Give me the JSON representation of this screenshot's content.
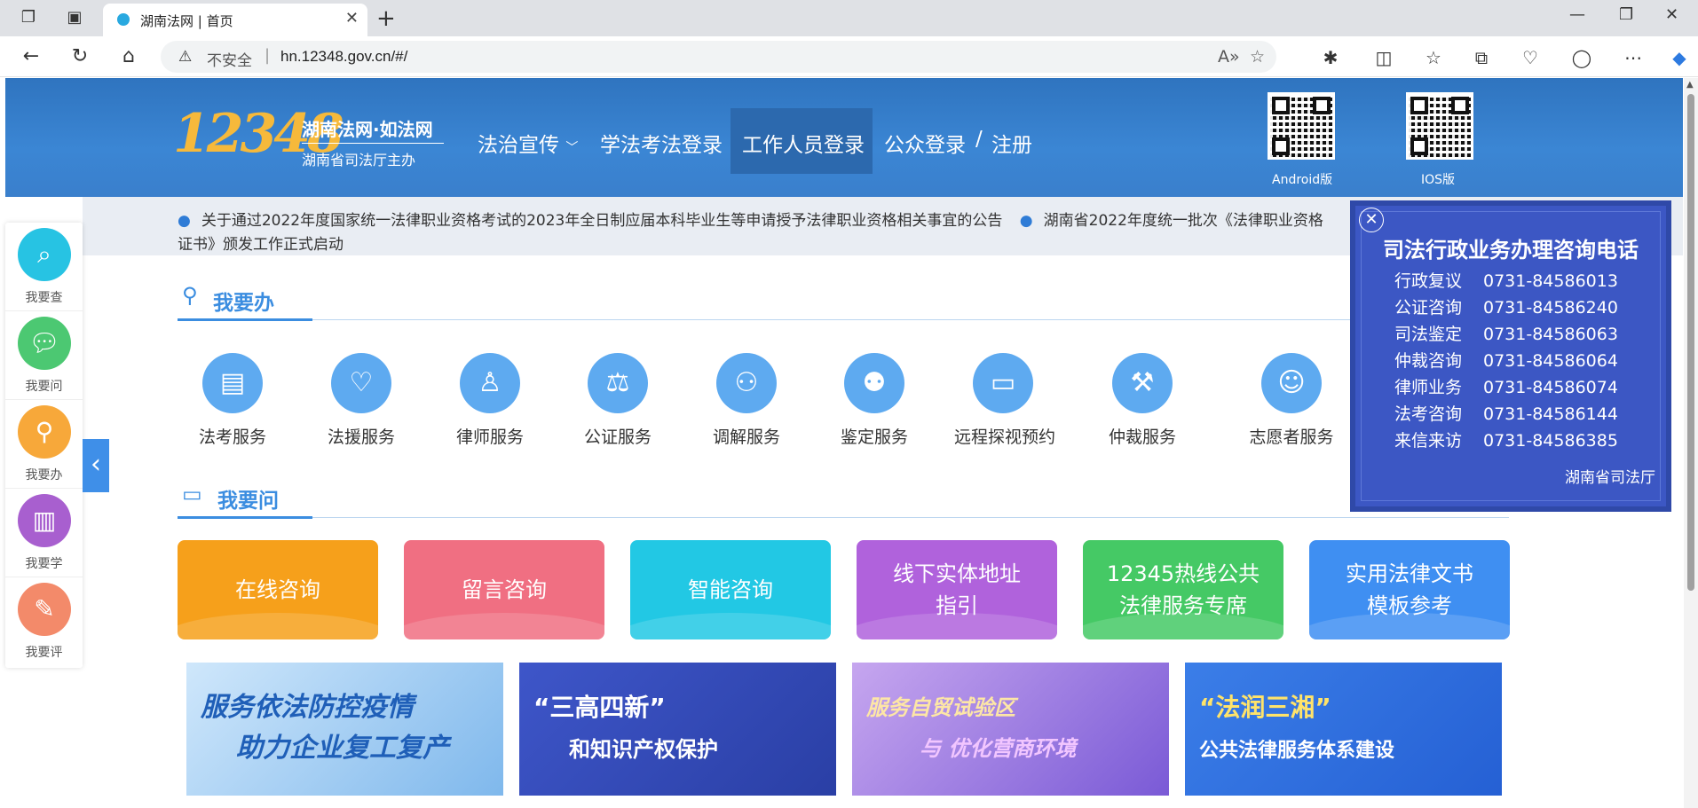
{
  "browser": {
    "tab_title": "湖南法网 | 首页",
    "security_label": "不安全",
    "url": "hn.12348.gov.cn/#/"
  },
  "site": {
    "logo_number": "12348",
    "logo_title": "湖南法网·如法网",
    "logo_subtitle": "湖南省司法厅主办",
    "nav": {
      "propaganda": "法治宣传",
      "exam_login": "学法考法登录",
      "staff_login": "工作人员登录",
      "public_login": "公众登录",
      "slash": "/",
      "register": "注册"
    },
    "qr": [
      {
        "label": "Android版"
      },
      {
        "label": "IOS版"
      }
    ],
    "notices": [
      "关于通过2022年度国家统一法律职业资格考试的2023年全日制应届本科毕业生等申请授予法律职业资格相关事宜的公告",
      "湖南省2022年度统一批次《法律职业资格证书》颁发工作正式启动"
    ]
  },
  "sidebar": [
    {
      "label": "我要查",
      "icon": "search-doc-icon",
      "color": "#27c3e3"
    },
    {
      "label": "我要问",
      "icon": "chat-icon",
      "color": "#4cc872"
    },
    {
      "label": "我要办",
      "icon": "pin-icon",
      "color": "#f7a83a"
    },
    {
      "label": "我要学",
      "icon": "book-icon",
      "color": "#a85fcf"
    },
    {
      "label": "我要评",
      "icon": "edit-icon",
      "color": "#f38a6a"
    }
  ],
  "sections": {
    "do": "我要办",
    "ask": "我要问"
  },
  "services": [
    {
      "label": "法考服务",
      "icon": "certificate-icon"
    },
    {
      "label": "法援服务",
      "icon": "heart-hands-icon"
    },
    {
      "label": "律师服务",
      "icon": "lawyer-icon"
    },
    {
      "label": "公证服务",
      "icon": "scales-icon"
    },
    {
      "label": "调解服务",
      "icon": "mediation-icon"
    },
    {
      "label": "鉴定服务",
      "icon": "stamp-icon"
    },
    {
      "label": "远程探视预约",
      "icon": "monitor-icon"
    },
    {
      "label": "仲裁服务",
      "icon": "gavel-icon"
    },
    {
      "label": "志愿者服务",
      "icon": "volunteer-icon"
    }
  ],
  "cards": [
    {
      "line1": "在线咨询",
      "line2": "",
      "color": "#f6a01b"
    },
    {
      "line1": "留言咨询",
      "line2": "",
      "color": "#f06f82"
    },
    {
      "line1": "智能咨询",
      "line2": "",
      "color": "#22c8e4"
    },
    {
      "line1": "线下实体地址",
      "line2": "指引",
      "color": "#b062dc"
    },
    {
      "line1": "12345热线公共",
      "line2": "法律服务专席",
      "color": "#45c965"
    },
    {
      "line1": "实用法律文书",
      "line2": "模板参考",
      "color": "#3f8ff2"
    }
  ],
  "banners": [
    {
      "line1": "服务依法防控疫情",
      "line2": "助力企业复工复产"
    },
    {
      "line1": "“三高四新”",
      "line2": "和知识产权保护"
    },
    {
      "line1": "服务自贸试验区",
      "line2": "与 优化营商环境"
    },
    {
      "line1": "“法润三湘”",
      "line2": "公共法律服务体系建设"
    }
  ],
  "popup": {
    "title": "司法行政业务办理咨询电话",
    "rows": [
      {
        "k": "行政复议",
        "v": "0731-84586013"
      },
      {
        "k": "公证咨询",
        "v": "0731-84586240"
      },
      {
        "k": "司法鉴定",
        "v": "0731-84586063"
      },
      {
        "k": "仲裁咨询",
        "v": "0731-84586064"
      },
      {
        "k": "律师业务",
        "v": "0731-84586074"
      },
      {
        "k": "法考咨询",
        "v": "0731-84586144"
      },
      {
        "k": "来信来访",
        "v": "0731-84586385"
      }
    ],
    "signature": "湖南省司法厅"
  }
}
